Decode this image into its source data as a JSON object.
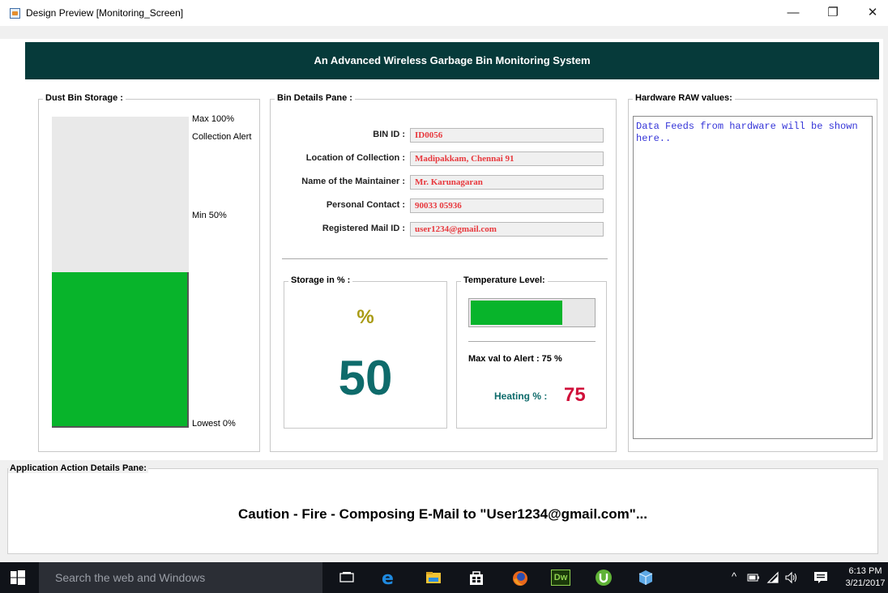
{
  "window": {
    "title": "Design Preview [Monitoring_Screen]",
    "minimize": "—",
    "restore": "❐",
    "close": "✕"
  },
  "header": {
    "title": "An Advanced Wireless Garbage Bin Monitoring System"
  },
  "dust_bin": {
    "title": "Dust Bin Storage :",
    "max_label": "Max 100%",
    "alert_label": "Collection Alert",
    "min_label": "Min 50%",
    "lowest_label": "Lowest 0%",
    "fill_fraction": 0.5,
    "fill_color": "#08b42b"
  },
  "bin_details": {
    "title": "Bin Details Pane :",
    "fields": [
      {
        "label": "BIN ID :",
        "value": "ID0056"
      },
      {
        "label": "Location of Collection :",
        "value": "Madipakkam, Chennai 91"
      },
      {
        "label": "Name of the Maintainer :",
        "value": "Mr. Karunagaran"
      },
      {
        "label": "Personal Contact :",
        "value": "90033 05936"
      },
      {
        "label": "Registered Mail ID :",
        "value": "user1234@gmail.com"
      }
    ]
  },
  "storage": {
    "title": "Storage in % :",
    "unit": "%",
    "value": "50"
  },
  "temperature": {
    "title": "Temperature Level:",
    "bar_fraction": 0.75,
    "max_alert_label": "Max val to Alert : 75 %",
    "heating_label": "Heating % :",
    "heating_value": "75"
  },
  "hardware": {
    "title": "Hardware RAW values:",
    "text": "Data Feeds from hardware will be shown here.."
  },
  "action_pane": {
    "title": "Application Action Details Pane:",
    "message": "Caution - Fire - Composing E-Mail to \"User1234@gmail.com\"..."
  },
  "taskbar": {
    "search_placeholder": "Search the web and Windows",
    "time": "6:13 PM",
    "date": "3/21/2017",
    "icons": [
      "windows-start-icon",
      "task-view-icon",
      "edge-icon",
      "file-explorer-icon",
      "store-icon",
      "firefox-icon",
      "dreamweaver-icon",
      "utorrent-icon",
      "virtualbox-icon"
    ],
    "dw_text": "Dw"
  },
  "colors": {
    "header_bg": "#063a3a",
    "field_text": "#e8383d",
    "storage_value": "#0e6b6b",
    "storage_unit": "#a89a12",
    "heating_value": "#d0103a",
    "heating_label": "#0e6b6b",
    "raw_text": "#3535d8",
    "green": "#08b42b"
  }
}
